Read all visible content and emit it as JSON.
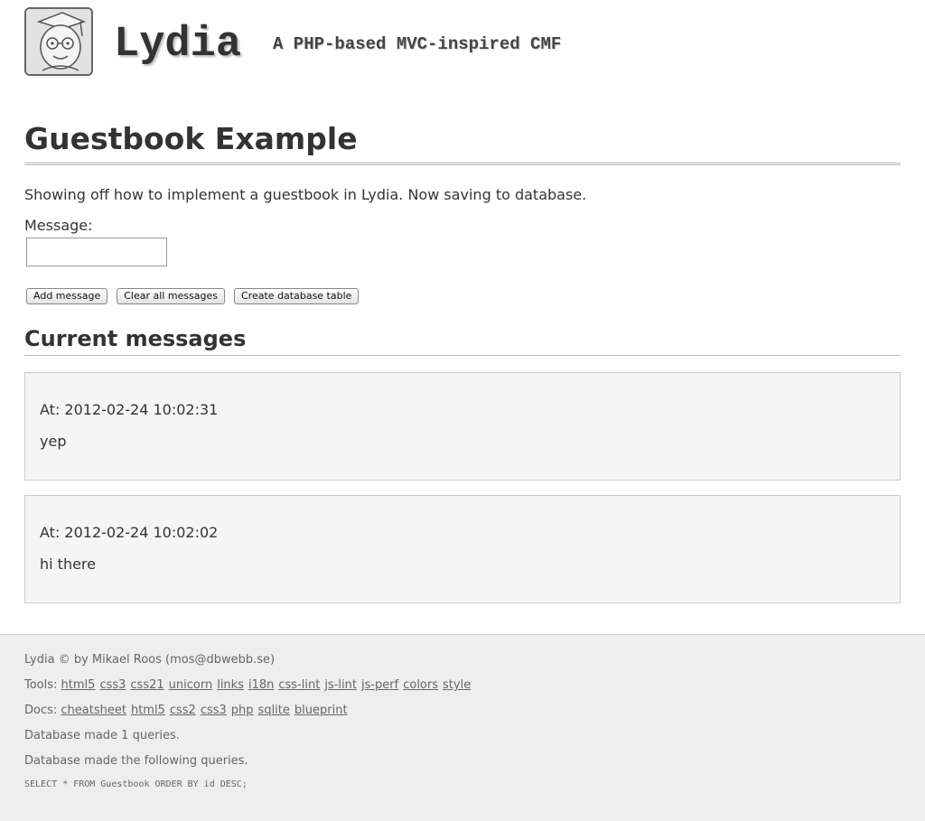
{
  "header": {
    "title": "Lydia",
    "slogan": "A PHP-based MVC-inspired CMF",
    "logo_icon": "owl-graduate-logo-icon"
  },
  "main": {
    "heading": "Guestbook Example",
    "intro": "Showing off how to implement a guestbook in Lydia. Now saving to database.",
    "form": {
      "message_label": "Message:",
      "message_value": "",
      "buttons": {
        "add": "Add message",
        "clear": "Clear all messages",
        "create": "Create database table"
      }
    },
    "current_heading": "Current messages",
    "messages": [
      {
        "at": "At: 2012-02-24 10:02:31",
        "text": "yep"
      },
      {
        "at": "At: 2012-02-24 10:02:02",
        "text": "hi there"
      }
    ]
  },
  "footer": {
    "copyright": "Lydia © by Mikael Roos (mos@dbwebb.se)",
    "tools_label": "Tools:",
    "tools": [
      "html5",
      "css3",
      "css21",
      "unicorn",
      "links",
      "i18n",
      "css-lint",
      "js-lint",
      "js-perf",
      "colors",
      "style"
    ],
    "docs_label": "Docs:",
    "docs": [
      "cheatsheet",
      "html5",
      "css2",
      "css3",
      "php",
      "sqlite",
      "blueprint"
    ],
    "queries_count": "Database made 1 queries.",
    "queries_label": "Database made the following queries.",
    "query": "SELECT * FROM Guestbook ORDER BY id DESC;"
  },
  "colors": {
    "background": "#ffffff",
    "text": "#333333",
    "message_bg": "#f5f5f5",
    "footer_bg": "#eeeeee"
  }
}
